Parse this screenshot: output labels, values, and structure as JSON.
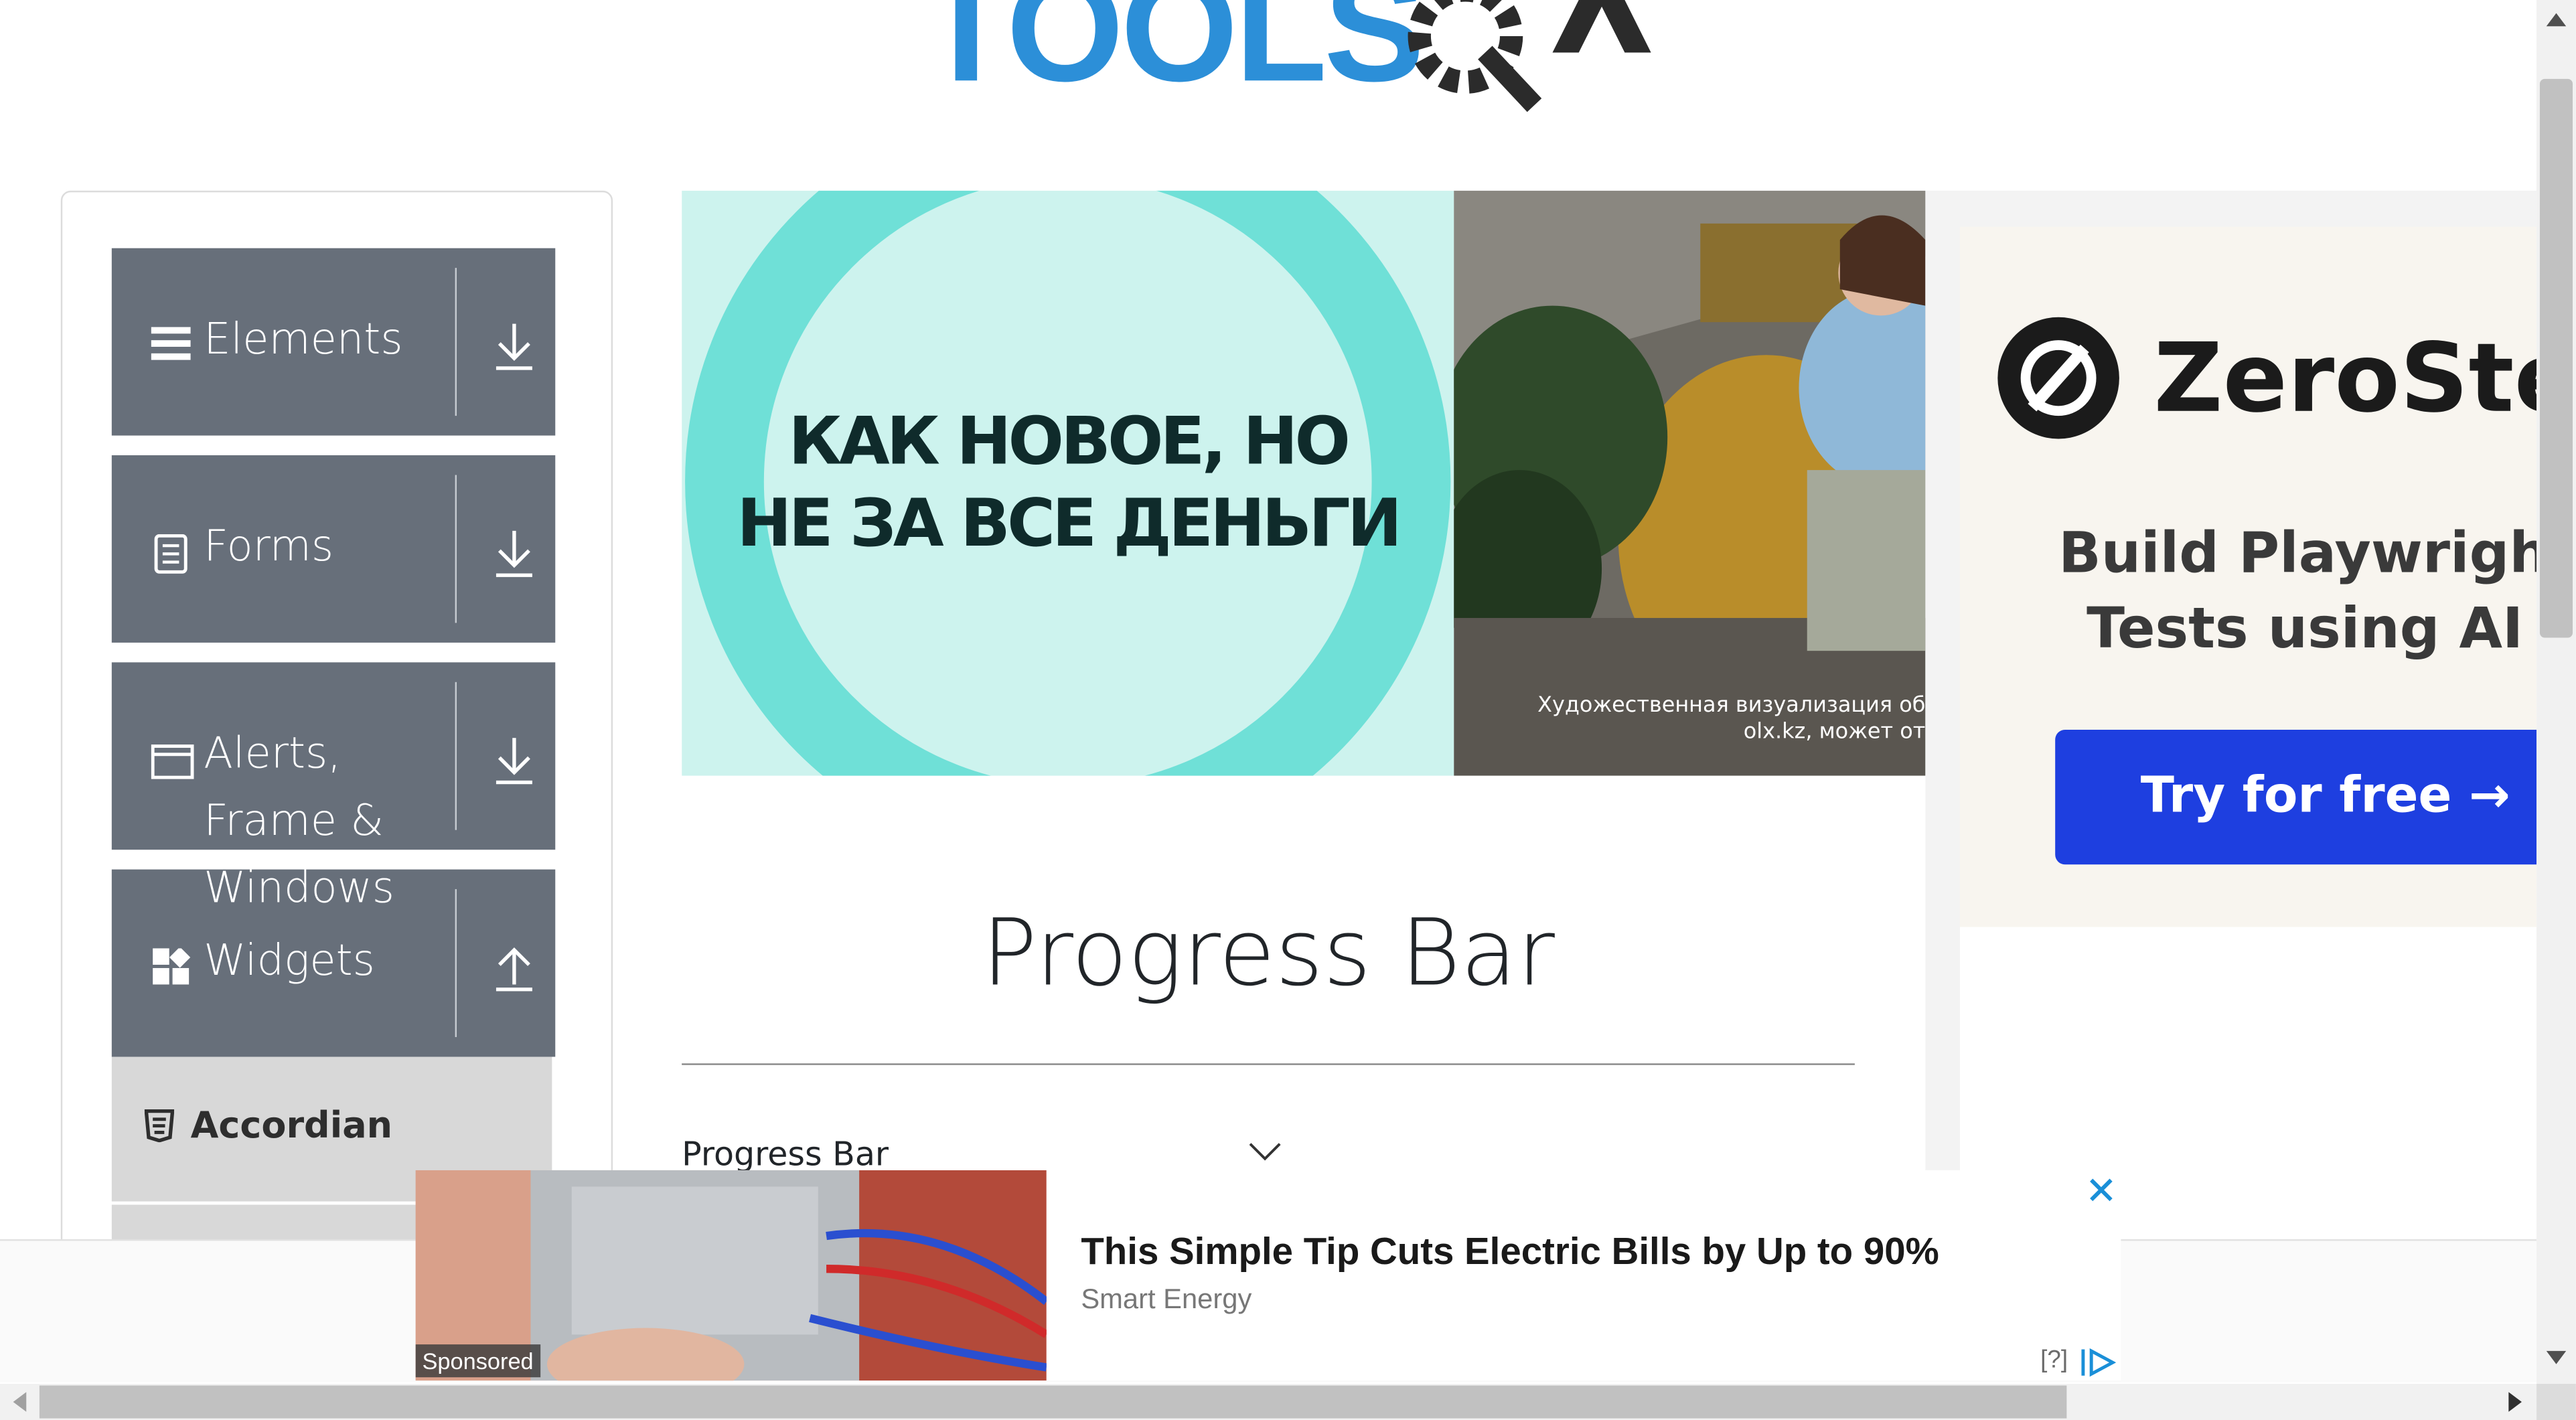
{
  "logo": {
    "part1": "TOOLS",
    "part2": "QA"
  },
  "sidebar": {
    "groups": [
      {
        "label": "Elements",
        "icon": "hamburger-icon",
        "arrow": "download-arrow-icon"
      },
      {
        "label": "Forms",
        "icon": "document-icon",
        "arrow": "download-arrow-icon"
      },
      {
        "label_line1": "Alerts,",
        "label_line2": "Frame &",
        "label_line3": "Windows",
        "icon": "window-icon",
        "arrow": "download-arrow-icon"
      },
      {
        "label": "Widgets",
        "icon": "widgets-icon",
        "arrow": "upload-arrow-icon"
      }
    ],
    "active_item": {
      "label": "Accordian",
      "icon": "html5-icon"
    }
  },
  "ad_banner": {
    "headline_line1": "КАК НОВОЕ, НО",
    "headline_line2": "НЕ ЗА ВСЕ ДЕНЬГИ",
    "caption_line1": "Художественная визуализация об",
    "caption_line2": "olx.kz, может от"
  },
  "right_ad": {
    "brand": "ZeroSte",
    "promo_line1": "Build Playwright",
    "promo_line2": "Tests using AI",
    "cta": "Try for free →",
    "cta_color": "#1e3fe0"
  },
  "main": {
    "title": "Progress Bar",
    "section_label": "Progress Bar"
  },
  "bottom_ad": {
    "sponsored": "Sponsored",
    "title": "This Simple Tip Cuts Electric Bills by Up to 90%",
    "source": "Smart Energy",
    "adchoices": "[?]"
  },
  "colors": {
    "sidebar_group_bg": "#676f7a",
    "accent_blue": "#2c8fd8",
    "ad_teal": "#6fe0d7"
  }
}
